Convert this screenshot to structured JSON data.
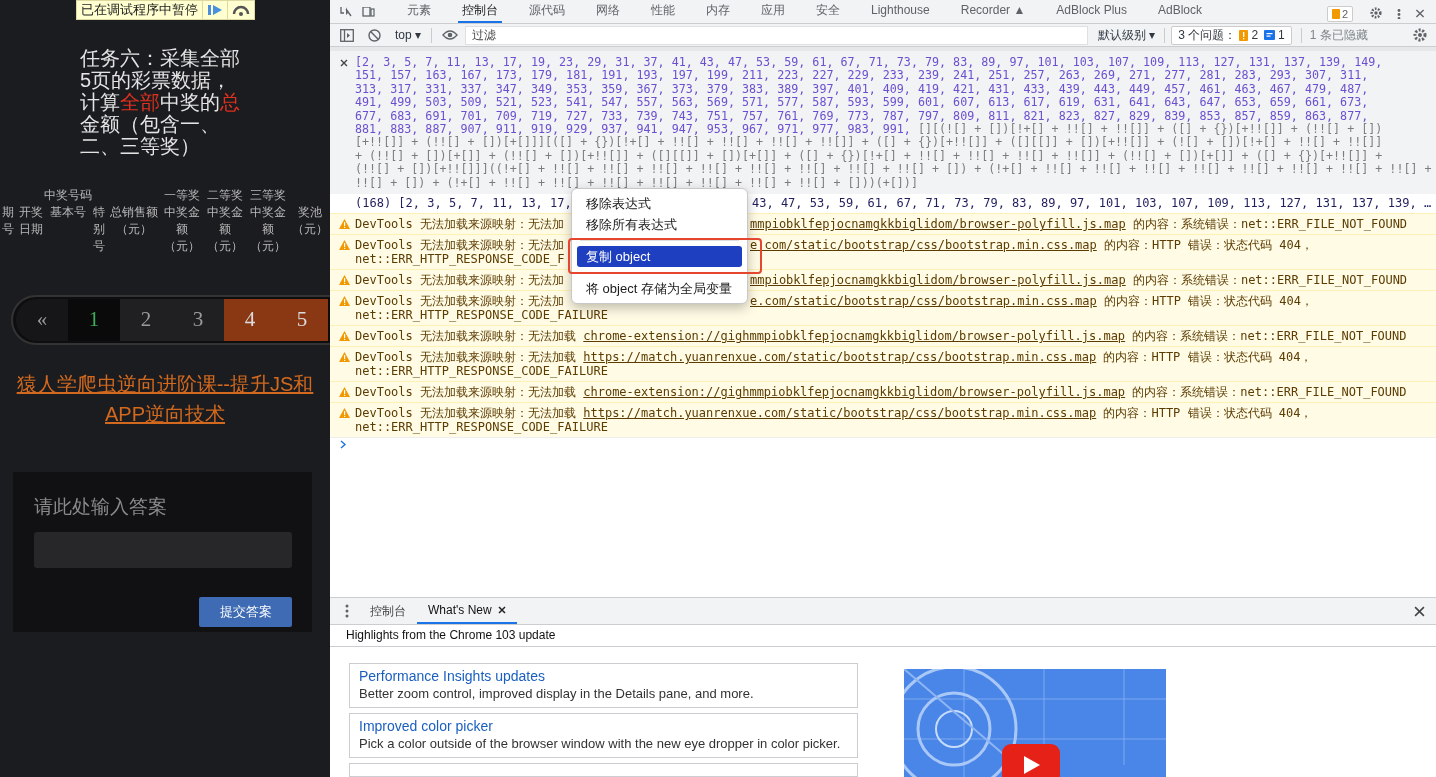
{
  "page": {
    "paused_banner": "已在调试程序中暂停",
    "task_title": [
      [
        {
          "text": "任务六：采集全部",
          "highlight": false
        }
      ],
      [
        {
          "text": "5页的彩票数据，",
          "highlight": false
        }
      ],
      [
        {
          "text": "计算",
          "highlight": false
        },
        {
          "text": "全部",
          "highlight": true
        },
        {
          "text": "中奖的",
          "highlight": false
        },
        {
          "text": "总",
          "highlight": true
        }
      ],
      [
        {
          "text": "金额（包含一、",
          "highlight": false
        }
      ],
      [
        {
          "text": "二、三等奖）",
          "highlight": false
        }
      ]
    ],
    "table_columns": [
      {
        "label": "期号"
      },
      {
        "label": "开奖日期"
      },
      {
        "label": "基本号",
        "group": "中奖号码"
      },
      {
        "label": "特别号"
      },
      {
        "label": "总销售额（元）"
      },
      {
        "label": "中奖金额（元）",
        "group": "一等奖"
      },
      {
        "label": "中奖金额（元）",
        "group": "二等奖"
      },
      {
        "label": "中奖金额（元）",
        "group": "三等奖"
      },
      {
        "label": "奖池（元）"
      }
    ],
    "pagination": [
      {
        "label": "«",
        "selected": false,
        "highlighted": false
      },
      {
        "label": "1",
        "selected": true,
        "highlighted": false
      },
      {
        "label": "2",
        "selected": false,
        "highlighted": false
      },
      {
        "label": "3",
        "selected": false,
        "highlighted": false
      },
      {
        "label": "4",
        "selected": false,
        "highlighted": true
      },
      {
        "label": "5",
        "selected": false,
        "highlighted": true
      }
    ],
    "course_link": "猿人学爬虫逆向进阶课--提升JS和APP逆向技术",
    "answer": {
      "label": "请此处输入答案",
      "submit": "提交答案"
    }
  },
  "devtools": {
    "main_tabs": [
      {
        "label": "元素",
        "selected": false
      },
      {
        "label": "控制台",
        "selected": true
      },
      {
        "label": "源代码",
        "selected": false
      },
      {
        "label": "网络",
        "selected": false
      },
      {
        "label": "性能",
        "selected": false
      },
      {
        "label": "内存",
        "selected": false
      },
      {
        "label": "应用",
        "selected": false
      },
      {
        "label": "安全",
        "selected": false
      },
      {
        "label": "Lighthouse",
        "selected": false
      },
      {
        "label": "Recorder ▲",
        "selected": false
      },
      {
        "label": "AdBlock Plus",
        "selected": false
      },
      {
        "label": "AdBlock",
        "selected": false
      }
    ],
    "issues_badge": "2",
    "console_toolbar": {
      "context": "top ▾",
      "filter_placeholder": "过滤",
      "level": "默认级别 ▾",
      "issues_label": "3 个问题：",
      "warnings": "2",
      "infos": "1",
      "hidden": "1 条已隐藏"
    },
    "live_expression": [
      [
        {
          "kind": "number",
          "text": "[2, 3, 5, 7, 11, 13, 17, 19, 23, 29, 31, 37, 41, 43, 47, 53, 59, 61, 67, 71, 73, 79, 83, 89, 97, 101, 103, 107, 109, 113, 127, 131, 137, 139, 149,"
        }
      ],
      [
        {
          "kind": "number",
          "text": "151, 157, 163, 167, 173, 179, 181, 191, 193, 197, 199, 211, 223, 227, 229, 233, 239, 241, 251, 257, 263, 269, 271, 277, 281, 283, 293, 307, 311,"
        }
      ],
      [
        {
          "kind": "number",
          "text": "313, 317, 331, 337, 347, 349, 353, 359, 367, 373, 379, 383, 389, 397, 401, 409, 419, 421, 431, 433, 439, 443, 449, 457, 461, 463, 467, 479, 487,"
        }
      ],
      [
        {
          "kind": "number",
          "text": "491, 499, 503, 509, 521, 523, 541, 547, 557, 563, 569, 571, 577, 587, 593, 599, 601, 607, 613, 617, 619, 631, 641, 643, 647, 653, 659, 661, 673,"
        }
      ],
      [
        {
          "kind": "number",
          "text": "677, 683, 691, 701, 709, 719, 727, 733, 739, 743, 751, 757, 761, 769, 773, 787, 797, 809, 811, 821, 823, 827, 829, 839, 853, 857, 859, 863, 877,"
        }
      ],
      [
        {
          "kind": "number",
          "text": "881, 883, 887, 907, 911, 919, 929, 937, 941, 947, 953, 967, 971, 977, 983, 991, "
        },
        {
          "kind": "code",
          "text": "[][(![] + [])[!+[] + !![] + !![]] + ([] + {})[+!![]] + (!![] + [])"
        }
      ],
      [
        {
          "kind": "code",
          "text": "[+!![]] + (!![] + [])[+[]]][([] + {})[!+[] + !![] + !![] + !![] + !![]] + ([] + {})[+!![]] + ([][[]] + [])[+!![]] + (![] + [])[!+[] + !![] + !![]]"
        }
      ],
      [
        {
          "kind": "code",
          "text": "+ (!![] + [])[+[]] + (!![] + [])[+!![]] + ([][[]] + [])[+[]] + ([] + {})[!+[] + !![] + !![] + !![] + !![]] + (!![] + [])[+[]] + ([] + {})[+!![]] +"
        }
      ],
      [
        {
          "kind": "code",
          "text": "(!![] + [])[+!![]]]((!+[] + !![] + !![] + !![] + !![] + !![] + !![] + !![] + !![] + []) + (!+[] + !![] + !![] + !![] + !![] + !![] + !![] + !![] + !![] +"
        }
      ],
      [
        {
          "kind": "code",
          "text": "!![] + []) + (!+[] + !![] + !![] + !![] + !![] + !![] + !![] + !![] + []))(+[])]"
        }
      ]
    ],
    "result": {
      "before_menu": "(168) [2, 3, 5, 7, 11, 13, 17,",
      "after_menu": "43, 47, 53, 59, 61, 67, 71, 73, 79, 83, 89, 97, 101, 103, 107, 109, 113, 127, 131, 137, 139, …"
    },
    "messages": [
      {
        "kind": "covered",
        "prefix": "DevTools 无法加载来源映射：无法加",
        "url": "mmpiobklfepjocnamgkkbiglidom/browser-polyfill.js.map",
        "suffix": " 的内容：系统错误：net::ERR_FILE_NOT_FOUND"
      },
      {
        "kind": "covered",
        "prefix": "DevTools 无法加载来源映射：无法加",
        "url": "e.com/static/bootstrap/css/bootstrap.min.css.map",
        "suffix": " 的内容：HTTP 错误：状态代码 404，",
        "line2": "net::ERR_HTTP_RESPONSE_CODE_F"
      },
      {
        "kind": "covered",
        "prefix": "DevTools 无法加载来源映射：无法加",
        "url": "mmpiobklfepjocnamgkkbiglidom/browser-polyfill.js.map",
        "suffix": " 的内容：系统错误：net::ERR_FILE_NOT_FOUND"
      },
      {
        "kind": "covered",
        "prefix": "DevTools 无法加载来源映射：无法加",
        "url": "e.com/static/bootstrap/css/bootstrap.min.css.map",
        "suffix": " 的内容：HTTP 错误：状态代码 404，",
        "line2": "net::ERR_HTTP_RESPONSE_CODE_FAILURE"
      },
      {
        "kind": "full",
        "prefix": "DevTools 无法加载来源映射：无法加载 ",
        "url": "chrome-extension://gighmmpiobklfepjocnamgkkbiglidom/browser-polyfill.js.map",
        "suffix": " 的内容：系统错误：net::ERR_FILE_NOT_FOUND"
      },
      {
        "kind": "full",
        "prefix": "DevTools 无法加载来源映射：无法加载 ",
        "url": "https://match.yuanrenxue.com/static/bootstrap/css/bootstrap.min.css.map",
        "suffix": " 的内容：HTTP 错误：状态代码 404，",
        "line2": "net::ERR_HTTP_RESPONSE_CODE_FAILURE"
      },
      {
        "kind": "full",
        "prefix": "DevTools 无法加载来源映射：无法加载 ",
        "url": "chrome-extension://gighmmpiobklfepjocnamgkkbiglidom/browser-polyfill.js.map",
        "suffix": " 的内容：系统错误：net::ERR_FILE_NOT_FOUND"
      },
      {
        "kind": "full",
        "prefix": "DevTools 无法加载来源映射：无法加载 ",
        "url": "https://match.yuanrenxue.com/static/bootstrap/css/bootstrap.min.css.map",
        "suffix": " 的内容：HTTP 错误：状态代码 404，",
        "line2": "net::ERR_HTTP_RESPONSE_CODE_FAILURE"
      }
    ],
    "context_menu": [
      {
        "kind": "item",
        "label": "移除表达式",
        "selected": false
      },
      {
        "kind": "item",
        "label": "移除所有表达式",
        "selected": false
      },
      {
        "kind": "separator"
      },
      {
        "kind": "item",
        "label": "复制 object",
        "selected": true
      },
      {
        "kind": "separator"
      },
      {
        "kind": "item",
        "label": "将 object 存储为全局变量",
        "selected": false
      }
    ],
    "drawer": {
      "tabs": [
        {
          "label": "控制台",
          "selected": false,
          "closable": false
        },
        {
          "label": "What's New",
          "selected": true,
          "closable": true
        }
      ],
      "header": "Highlights from the Chrome 103 update",
      "cards": [
        {
          "title": "Performance Insights updates",
          "description": "Better zoom control, improved display in the Details pane, and more."
        },
        {
          "title": "Improved color picker",
          "description": "Pick a color outside of the browser window with the new eye dropper in color picker."
        }
      ]
    }
  }
}
